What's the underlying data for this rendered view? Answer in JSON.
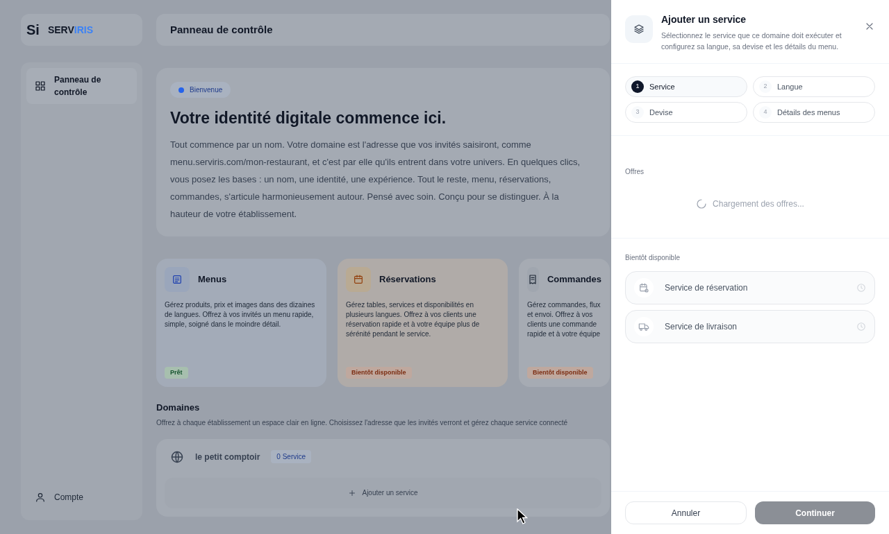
{
  "background": {
    "logo": {
      "mark": "Si",
      "name_dark": "SERV",
      "name_accent": "IRIS"
    },
    "header_title": "Panneau de contrôle",
    "sidebar": {
      "items": [
        {
          "label": "Panneau de contrôle",
          "selected": true
        }
      ],
      "footer_item": "Compte"
    },
    "welcome": {
      "badge": "Bienvenue",
      "title": "Votre identité digitale commence ici.",
      "text": "Tout commence par un nom. Votre domaine est l'adresse que vos invités saisiront, comme menu.serviris.com/mon-restaurant, et c'est par elle qu'ils entrent dans votre univers. En quelques clics, vous posez les bases : un nom, une identité, une expérience. Tout le reste, menu, réservations, commandes, s'articule harmonieusement autour. Pensé avec soin. Conçu pour se distinguer. À la hauteur de votre établissement."
    },
    "feature_cards": [
      {
        "kind": "menus",
        "title": "Menus",
        "text": "Gérez produits, prix et images dans des dizaines de langues. Offrez à vos invités un menu rapide, simple, soigné dans le moindre détail.",
        "badge": "Prêt",
        "ready": true
      },
      {
        "kind": "reservations",
        "title": "Réservations",
        "text": "Gérez tables, services et disponibilités en plusieurs langues. Offrez à vos clients une réservation rapide et à votre équipe plus de sérénité pendant le service.",
        "badge": "Bientôt disponible",
        "ready": false
      },
      {
        "kind": "orders",
        "title": "Commandes",
        "text": "Gérez commandes, flux et envoi. Offrez à vos clients une commande rapide et à votre équipe",
        "badge": "Bientôt disponible",
        "ready": false
      }
    ],
    "domains": {
      "title": "Domaines",
      "text": "Offrez à chaque établissement un espace clair en ligne. Choisissez l'adresse que les invités verront et gérez chaque service connecté",
      "items": [
        {
          "name": "le petit comptoir",
          "badge": "0 Service",
          "add_label": "Ajouter un service"
        }
      ]
    }
  },
  "dialog": {
    "title": "Ajouter un service",
    "subtitle": "Sélectionnez le service que ce domaine doit exécuter et configurez sa langue, sa devise et les détails du menu.",
    "steps": [
      {
        "number": "1",
        "label": "Service",
        "selected": true
      },
      {
        "number": "2",
        "label": "Langue",
        "selected": false
      },
      {
        "number": "3",
        "label": "Devise",
        "selected": false
      },
      {
        "number": "4",
        "label": "Détails des menus",
        "selected": false
      }
    ],
    "offers": {
      "title": "Offres",
      "loading_text": "Chargement des offres..."
    },
    "coming_soon": {
      "title": "Bientôt disponible",
      "items": [
        {
          "kind": "reservation",
          "label": "Service de réservation"
        },
        {
          "kind": "delivery",
          "label": "Service de livraison"
        }
      ]
    },
    "buttons": {
      "cancel": "Annuler",
      "continue": "Continuer",
      "continue_disabled": true
    }
  }
}
